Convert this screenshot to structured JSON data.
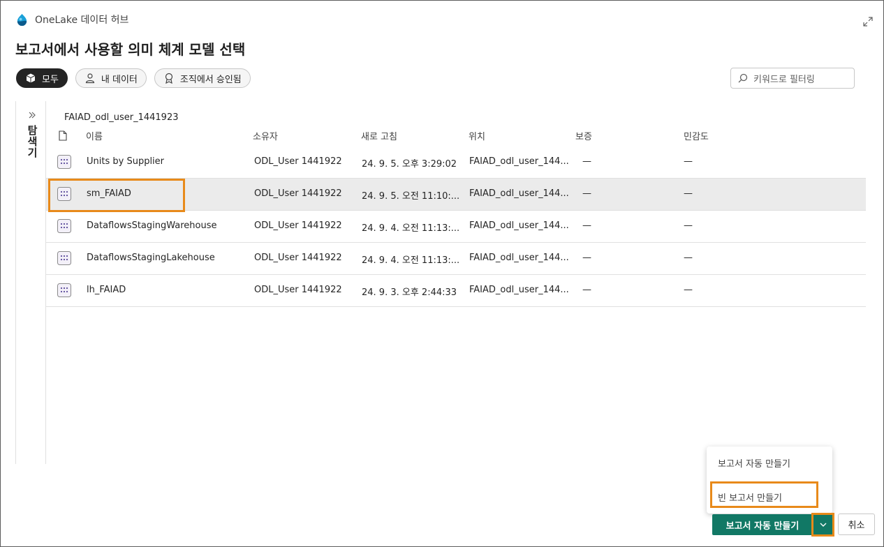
{
  "hub": {
    "title": "OneLake 데이터 허브"
  },
  "page": {
    "title": "보고서에서 사용할 의미 체계 모델 선택"
  },
  "chips": [
    {
      "label": "모두",
      "icon": "cube-icon",
      "active": true
    },
    {
      "label": "내 데이터",
      "icon": "person-icon",
      "active": false
    },
    {
      "label": "조직에서 승인됨",
      "icon": "ribbon-icon",
      "active": false
    }
  ],
  "filter": {
    "placeholder": "키워드로 필터링"
  },
  "explorer": {
    "label": "탐색기"
  },
  "breadcrumb": "FAIAD_odl_user_1441923",
  "columns": {
    "name": "이름",
    "owner": "소유자",
    "refreshed": "새로 고침",
    "location": "위치",
    "endorsement": "보증",
    "sensitivity": "민감도"
  },
  "rows": [
    {
      "name": "Units by Supplier",
      "owner": "ODL_User 1441922",
      "refreshed": "24. 9. 5. 오후 3:29:02",
      "location": "FAIAD_odl_user_144...",
      "endorsement": "—",
      "sensitivity": "—",
      "selected": false
    },
    {
      "name": "sm_FAIAD",
      "owner": "ODL_User 1441922",
      "refreshed": "24. 9. 5. 오전 11:10:...",
      "location": "FAIAD_odl_user_144...",
      "endorsement": "—",
      "sensitivity": "—",
      "selected": true
    },
    {
      "name": "DataflowsStagingWarehouse",
      "owner": "ODL_User 1441922",
      "refreshed": "24. 9. 4. 오전 11:13:...",
      "location": "FAIAD_odl_user_144...",
      "endorsement": "—",
      "sensitivity": "—",
      "selected": false
    },
    {
      "name": "DataflowsStagingLakehouse",
      "owner": "ODL_User 1441922",
      "refreshed": "24. 9. 4. 오전 11:13:...",
      "location": "FAIAD_odl_user_144...",
      "endorsement": "—",
      "sensitivity": "—",
      "selected": false
    },
    {
      "name": "lh_FAIAD",
      "owner": "ODL_User 1441922",
      "refreshed": "24. 9. 3. 오후 2:44:33",
      "location": "FAIAD_odl_user_144...",
      "endorsement": "—",
      "sensitivity": "—",
      "selected": false
    }
  ],
  "menu": {
    "auto_create": "보고서 자동 만들기",
    "blank_report": "빈 보고서 만들기"
  },
  "footer": {
    "primary_label": "보고서 자동 만들기",
    "cancel_label": "취소"
  },
  "colors": {
    "accent": "#117865",
    "highlight": "#e88a1a",
    "selected_row": "#ebebeb"
  }
}
